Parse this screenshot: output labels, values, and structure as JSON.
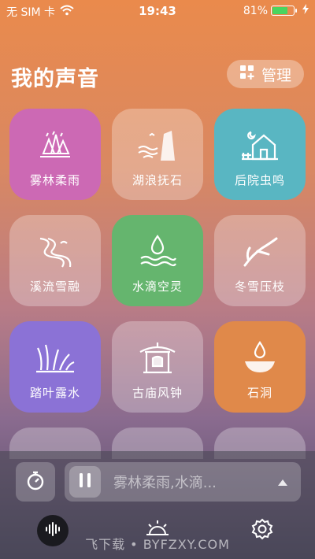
{
  "status": {
    "carrier": "无 SIM 卡",
    "time": "19:43",
    "battery_pct": "81%",
    "battery_level": 0.81,
    "accent": "#4ad55f"
  },
  "header": {
    "title": "我的声音",
    "manage_label": "管理"
  },
  "sounds": [
    {
      "label": "雾林柔雨",
      "icon": "misty-forest-icon",
      "color": "#cc69b4"
    },
    {
      "label": "湖浪抚石",
      "icon": "lake-wave-icon",
      "color": ""
    },
    {
      "label": "后院虫鸣",
      "icon": "backyard-house-icon",
      "color": "#59b6c2"
    },
    {
      "label": "溪流雪融",
      "icon": "stream-icon",
      "color": ""
    },
    {
      "label": "水滴空灵",
      "icon": "water-drop-icon",
      "color": "#65b56e"
    },
    {
      "label": "冬雪压枝",
      "icon": "branch-icon",
      "color": ""
    },
    {
      "label": "踏叶露水",
      "icon": "leaves-dew-icon",
      "color": "#8b72d6"
    },
    {
      "label": "古庙风钟",
      "icon": "temple-bell-icon",
      "color": ""
    },
    {
      "label": "石洞",
      "icon": "cave-drop-icon",
      "color": "#e0894a"
    }
  ],
  "player": {
    "now_playing": "雾林柔雨,水滴..."
  },
  "watermark": "飞下载 • BYFZXY.COM"
}
